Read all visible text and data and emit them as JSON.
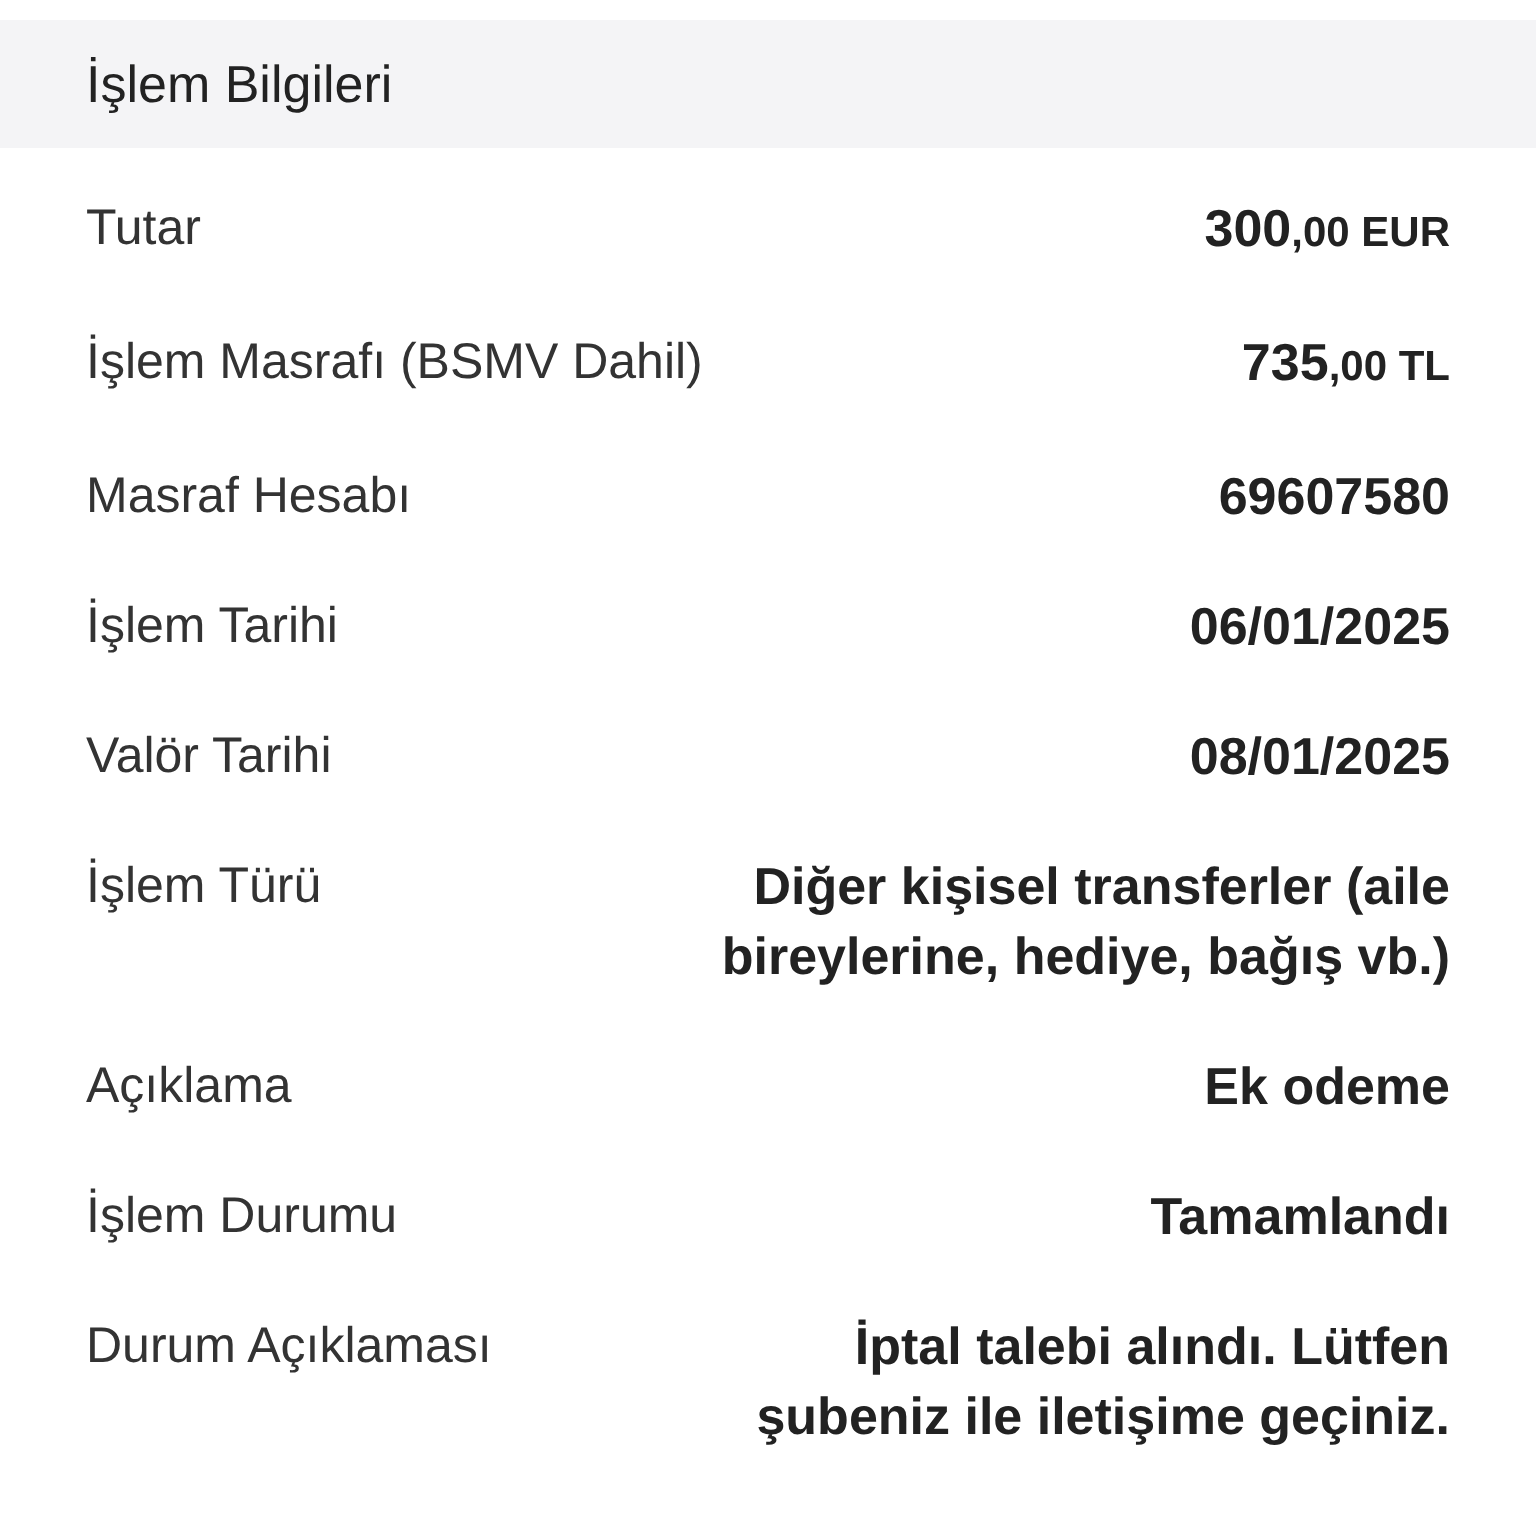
{
  "header": {
    "title": "İşlem Bilgileri"
  },
  "rows": [
    {
      "label": "Tutar",
      "kind": "amount",
      "value": "300",
      "fraction": ",00 EUR"
    },
    {
      "label": "İşlem Masrafı (BSMV Dahil)",
      "kind": "amount",
      "value": "735",
      "fraction": ",00 TL"
    },
    {
      "label": "Masraf Hesabı",
      "kind": "text",
      "value": "69607580"
    },
    {
      "label": "İşlem Tarihi",
      "kind": "text",
      "value": "06/01/2025"
    },
    {
      "label": "Valör Tarihi",
      "kind": "text",
      "value": "08/01/2025"
    },
    {
      "label": "İşlem Türü",
      "kind": "text",
      "value": "Diğer kişisel transferler (aile bireylerine, hediye, bağış vb.)"
    },
    {
      "label": "Açıklama",
      "kind": "text",
      "value": "Ek odeme"
    },
    {
      "label": "İşlem Durumu",
      "kind": "text",
      "value": "Tamamlandı"
    },
    {
      "label": "Durum Açıklaması",
      "kind": "text",
      "value": "İptal talebi alındı. Lütfen şubeniz ile iletişime geçiniz."
    }
  ]
}
